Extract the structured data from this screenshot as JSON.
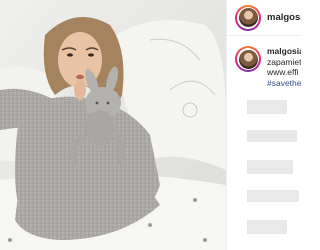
{
  "post": {
    "username": "malgosia_",
    "caption_lines": [
      "zapamieta",
      "www.effi",
      "#savethe"
    ]
  }
}
